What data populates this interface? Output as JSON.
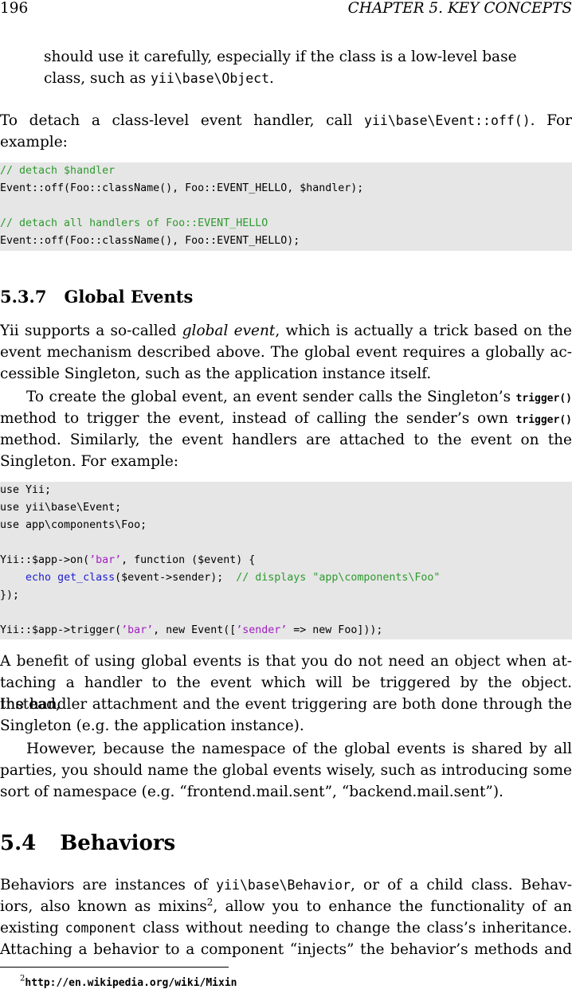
{
  "header": {
    "page_number": "196",
    "chapter": "CHAPTER 5.  KEY CONCEPTS"
  },
  "para_intro": {
    "line1": "should use it carefully, especially if the class is a low-level base",
    "line2_a": "class, such as ",
    "line2_code": "yii\\base\\Object",
    "line2_b": "."
  },
  "para_detach": {
    "line1_a": "To detach a class-level event handler, call ",
    "line1_code": "yii\\base\\Event::off()",
    "line1_b": ".  For",
    "line2": "example:"
  },
  "code1": {
    "l1": "// detach $handler",
    "l2": "Event::off(Foo::className(), Foo::EVENT_HELLO, $handler);",
    "l3": "// detach all handlers of Foo::EVENT_HELLO",
    "l4": "Event::off(Foo::className(), Foo::EVENT_HELLO);"
  },
  "section_537": {
    "number": "5.3.7",
    "title": "Global Events"
  },
  "para_global": {
    "l1_a": "Yii supports a so-called ",
    "l1_em": "global event",
    "l1_b": ", which is actually a trick based on the",
    "l2": "event mechanism described above.  The global event requires a globally ac-",
    "l3": "cessible Singleton, such as the application instance itself."
  },
  "para_create": {
    "l1_a": "To create the global event, an event sender calls the Singleton’s ",
    "l1_code": "trigger()",
    "l2_a": "method to trigger the event, instead of calling the sender’s own ",
    "l2_code": "trigger()",
    "l3": " method.  Similarly, the event handlers are attached to the event on the",
    "l4": "Singleton.  For example:"
  },
  "code2": {
    "l1": "use Yii;",
    "l2": "use yii\\base\\Event;",
    "l3": "use app\\components\\Foo;",
    "l4_a": "Yii::$app->on(",
    "l4_str": "’bar’",
    "l4_b": ", function ($event) {",
    "l5_indent": "    ",
    "l5_kw1": "echo",
    "l5_sp": " ",
    "l5_kw2": "get_class",
    "l5_b": "($event->sender);  ",
    "l5_cmt": "// displays \"app\\components\\Foo\"",
    "l6": "});",
    "l7_a": "Yii::$app->trigger(",
    "l7_str1": "’bar’",
    "l7_b": ", new Event([",
    "l7_str2": "’sender’",
    "l7_c": " => new Foo]));"
  },
  "para_benefit": {
    "l1": "A benefit of using global events is that you do not need an object when at-",
    "l2": "taching a handler to the event which will be triggered by the object.  Instead,",
    "l3": "the handler attachment and the event triggering are both done through the",
    "l4": "Singleton (e.g.  the application instance)."
  },
  "para_however": {
    "l1": "However, because the namespace of the global events is shared by all",
    "l2": "parties, you should name the global events wisely, such as introducing some",
    "l3": "sort of namespace (e.g.  “frontend.mail.sent”, “backend.mail.sent”)."
  },
  "section_54": {
    "number": "5.4",
    "title": "Behaviors"
  },
  "para_behaviors": {
    "l1_a": "Behaviors are instances of ",
    "l1_code": "yii\\base\\Behavior",
    "l1_b": ", or of a child class.  Behav-",
    "l2_a": "iors, also known as mixins",
    "l2_sup": "2",
    "l2_b": ", allow you to enhance the functionality of an",
    "l3_a": "existing ",
    "l3_code": "component",
    "l3_b": " class without needing to change the class’s inheritance.",
    "l4": "Attaching a behavior to a component “injects” the behavior’s methods and"
  },
  "footnote": {
    "mark": "2",
    "url": "http://en.wikipedia.org/wiki/Mixin"
  }
}
